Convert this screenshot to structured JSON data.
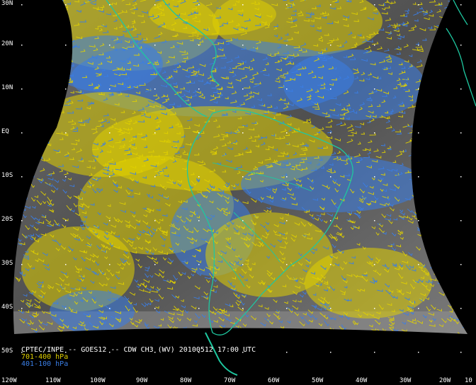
{
  "caption": {
    "title": "CPTEC/INPE -- GOES12 -- CDW CH3 (WV) 20100512 17:00 UTC",
    "legend": [
      {
        "label": "701-400 hPa",
        "color": "#e0d000"
      },
      {
        "label": "401-100 hPa",
        "color": "#3a7ee6"
      }
    ]
  },
  "lat_labels": [
    "30N",
    "20N",
    "10N",
    "EQ",
    "10S",
    "20S",
    "30S",
    "40S",
    "50S"
  ],
  "lon_labels": [
    "120W",
    "110W",
    "100W",
    "90W",
    "80W",
    "70W",
    "60W",
    "50W",
    "40W",
    "30W",
    "20W",
    "10"
  ],
  "colors": {
    "background": "#000000",
    "coastline": "#1ec8a0",
    "grid_dots": "#ffffff"
  }
}
